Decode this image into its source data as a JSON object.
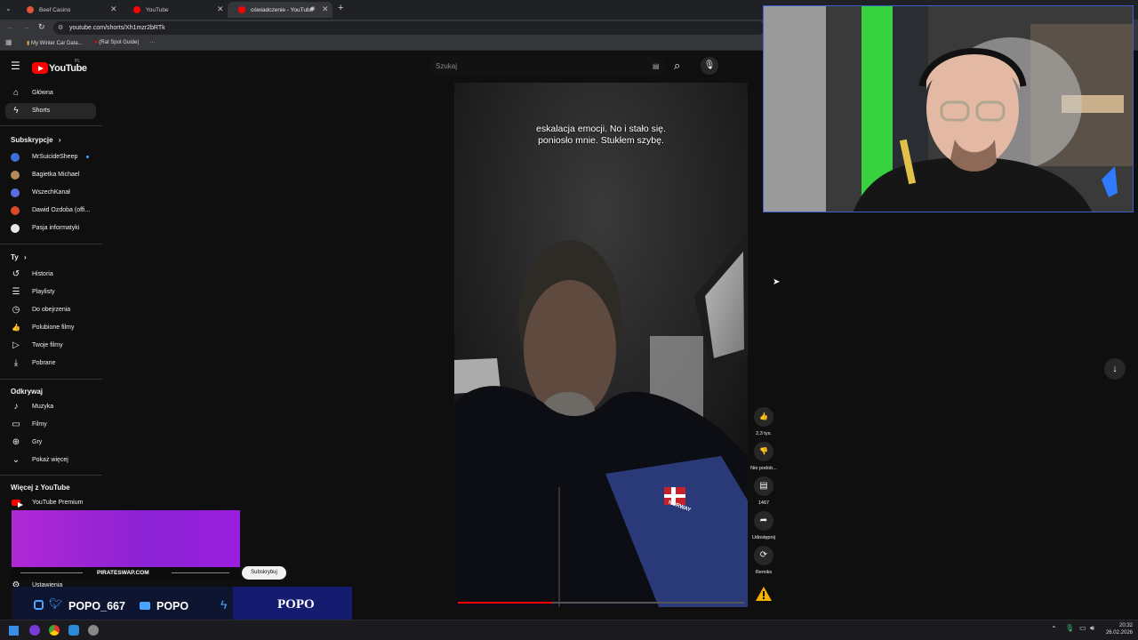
{
  "browser": {
    "tabs": [
      {
        "title": "Beef Casino",
        "active": false
      },
      {
        "title": "YouTube",
        "active": false
      },
      {
        "title": "oświadczenie - YouTube",
        "active": true
      }
    ],
    "url": "youtube.com/shorts/Xh1mzr2bRTk",
    "bookmarks": [
      "My Winter Car Data...",
      "(Rat Spot Guide)"
    ]
  },
  "header": {
    "logo_text": "YouTube",
    "region": "PL",
    "search_placeholder": "Szukaj"
  },
  "sidebar": {
    "main": [
      {
        "label": "Główna",
        "icon": "home-icon",
        "glyph": "⌂"
      },
      {
        "label": "Shorts",
        "icon": "shorts-icon",
        "glyph": "ϟ",
        "active": true
      }
    ],
    "subscriptions_title": "Subskrypcje",
    "subscriptions": [
      {
        "label": "MrSuicideSheep",
        "color": "#3a6fd8",
        "dot": true
      },
      {
        "label": "Bagietka Michael",
        "color": "#b58a5a"
      },
      {
        "label": "WszechKanał",
        "color": "#5b6ee0"
      },
      {
        "label": "Dawid Ozdoba (offi...",
        "color": "#d84a2a"
      },
      {
        "label": "Pasja informatyki",
        "color": "#e8e8e8"
      }
    ],
    "you_title": "Ty",
    "you": [
      {
        "label": "Historia",
        "icon": "history-icon",
        "glyph": "↺"
      },
      {
        "label": "Playlisty",
        "icon": "playlist-icon",
        "glyph": "☰"
      },
      {
        "label": "Do obejrzenia",
        "icon": "watch-later-icon",
        "glyph": "◷"
      },
      {
        "label": "Polubione filmy",
        "icon": "thumbs-up-icon",
        "glyph": "👍"
      },
      {
        "label": "Twoje filmy",
        "icon": "your-videos-icon",
        "glyph": "▷"
      },
      {
        "label": "Pobrane",
        "icon": "download-icon",
        "glyph": "⤓"
      }
    ],
    "explore_title": "Odkrywaj",
    "explore": [
      {
        "label": "Muzyka",
        "icon": "music-icon",
        "glyph": "♪"
      },
      {
        "label": "Filmy",
        "icon": "film-icon",
        "glyph": "▭"
      },
      {
        "label": "Gry",
        "icon": "gamepad-icon",
        "glyph": "⊕"
      },
      {
        "label": "Pokaż więcej",
        "icon": "chevron-down-icon",
        "glyph": "⌄"
      }
    ],
    "more_title": "Więcej z YouTube",
    "more": [
      {
        "label": "YouTube Premium",
        "icon": "yt-premium-icon"
      }
    ],
    "settings_label": "Ustawienia"
  },
  "video": {
    "subtitle_line1": "eskalacja emocji. No i stało się.",
    "subtitle_line2": "poniosło mnie. Stukłem szybę.",
    "jacket_text": "NORWAY",
    "progress": 0.33
  },
  "actions": [
    {
      "name": "like",
      "label": "2,3 tys.",
      "glyph": "👍"
    },
    {
      "name": "dislike",
      "label": "Nie podob...",
      "glyph": "👎"
    },
    {
      "name": "comments",
      "label": "1467",
      "glyph": "▤"
    },
    {
      "name": "share",
      "label": "Udostępnij",
      "glyph": "➦"
    },
    {
      "name": "remix",
      "label": "Remiks",
      "glyph": "⟳"
    }
  ],
  "overlay": {
    "promo_site": "PIRATESWAP.COM",
    "subscribe_label": "Subskrybuj",
    "social_handle": "POPO_667",
    "youtube_handle": "POPO",
    "brand_logo": "POPO"
  },
  "taskbar": {
    "time": "20:32",
    "date": "26.02.2026"
  },
  "colors": {
    "accent": "#ff0000",
    "background": "#0f0f0f",
    "promo": "#9b23d8",
    "banner": "#0d1530",
    "cam_border": "#3a5fcf"
  }
}
